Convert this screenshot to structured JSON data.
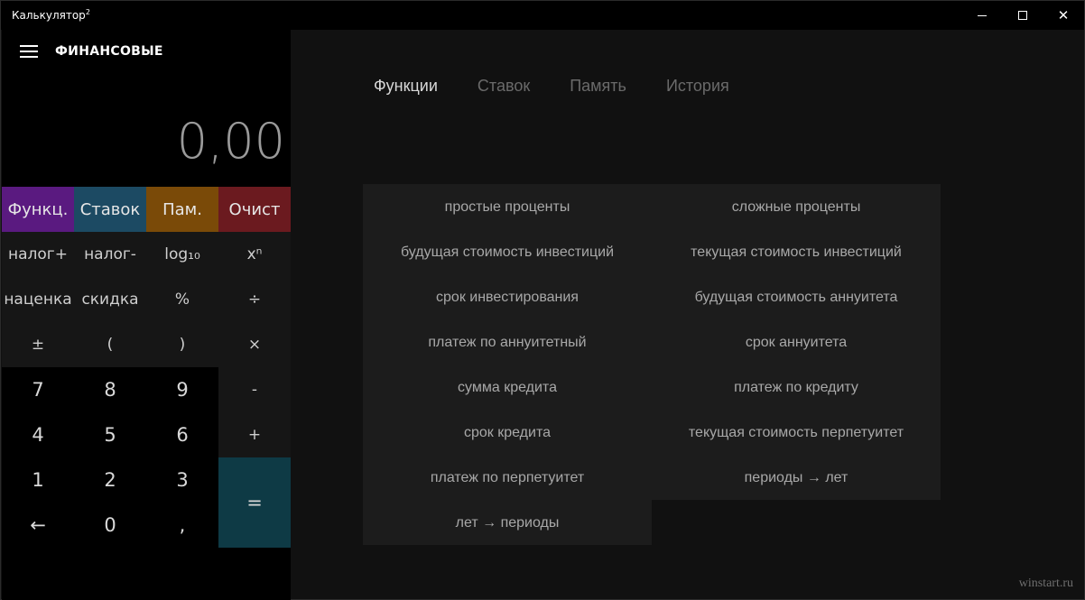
{
  "window": {
    "title": "Калькулятор",
    "title_sup": "2",
    "minimize_icon": "minimize-icon",
    "maximize_icon": "maximize-icon",
    "close_label": "✕"
  },
  "calc": {
    "mode_title": "ФИНАНСОВЫЕ",
    "display": "0,00",
    "top_row": [
      "Функц.",
      "Ставок",
      "Пам.",
      "Очист"
    ],
    "row2": [
      "налог+",
      "налог-",
      "log₁₀",
      "xⁿ"
    ],
    "row3": [
      "наценка",
      "скидка",
      "%",
      "÷"
    ],
    "row4": [
      "±",
      "(",
      ")",
      "×"
    ],
    "row5": [
      "7",
      "8",
      "9",
      "-"
    ],
    "row6": [
      "4",
      "5",
      "6",
      "+"
    ],
    "row7": [
      "1",
      "2",
      "3"
    ],
    "row8": [
      "←",
      "0",
      ","
    ],
    "equals": "="
  },
  "tabs": [
    "Функции",
    "Ставок",
    "Память",
    "История"
  ],
  "functions_left": [
    "простые проценты",
    "будущая стоимость инвестиций",
    "срок инвестирования",
    "платеж по аннуитетный",
    "сумма кредита",
    "срок кредита",
    "платеж по перпетуитет",
    "лет → периоды"
  ],
  "functions_right": [
    "сложные проценты",
    "текущая стоимость инвестиций",
    "будущая стоимость аннуитета",
    "срок аннуитета",
    "платеж по кредиту",
    "текущая стоимость перпетуитет",
    "периоды → лет"
  ],
  "watermark": "winstart.ru",
  "colors": {
    "func_key": "#5a1a80",
    "rate_key": "#1c4a63",
    "mem_key": "#7a4a08",
    "clear_key": "#6b1a1f",
    "equals_key": "#0e3a45"
  }
}
